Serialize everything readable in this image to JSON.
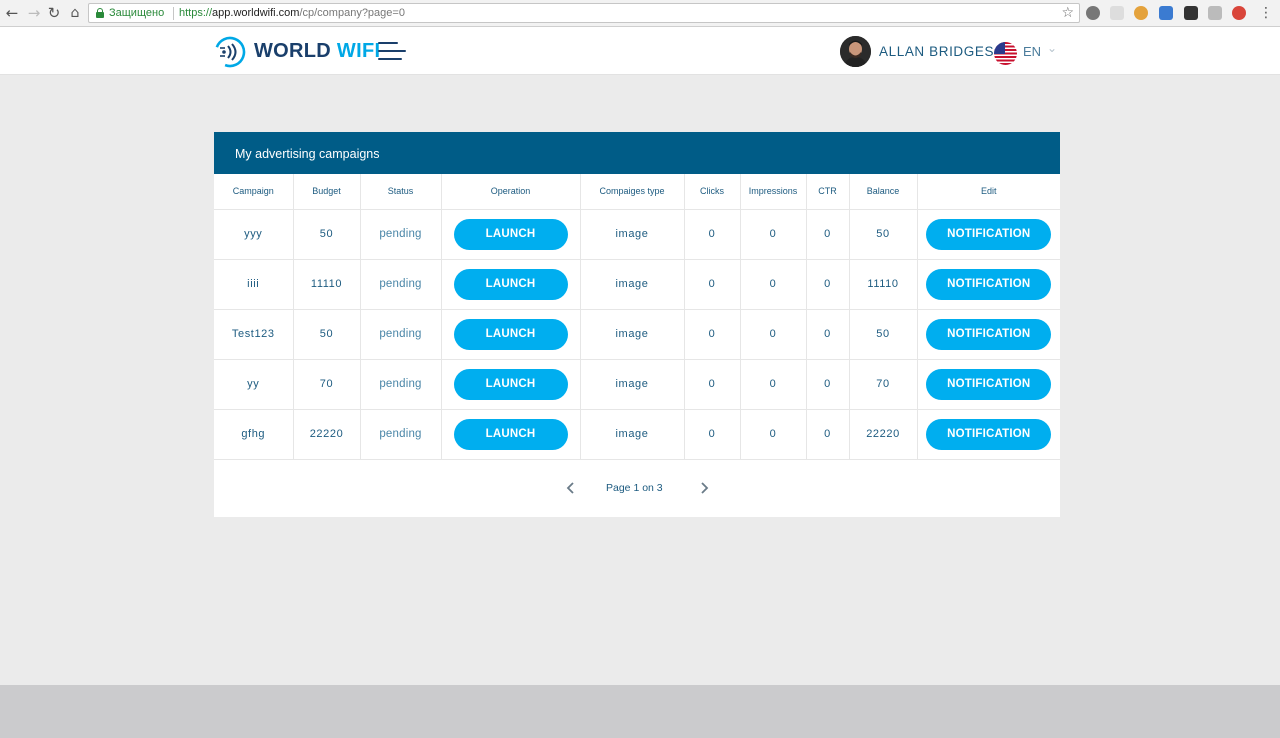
{
  "browser": {
    "secure_label": "Защищено",
    "url_scheme": "https://",
    "url_host": "app.worldwifi.com",
    "url_path": "/cp/company?page=0"
  },
  "header": {
    "logo_word1": "WORLD",
    "logo_word2": "WIFI",
    "user_name": "ALLAN BRIDGES",
    "language": "EN",
    "brand_color": "#00a8e6",
    "navy_color": "#1a3f6b"
  },
  "panel": {
    "title": "My advertising campaigns",
    "header_color": "#005c87",
    "columns": [
      "Campaign",
      "Budget",
      "Status",
      "Operation",
      "Compaiges type",
      "Clicks",
      "Impressions",
      "CTR",
      "Balance",
      "Edit"
    ],
    "rows": [
      {
        "campaign": "yyy",
        "budget": "50",
        "status": "pending",
        "operation": "LAUNCH",
        "type": "image",
        "clicks": "0",
        "impressions": "0",
        "ctr": "0",
        "balance": "50",
        "edit": "NOTIFICATION"
      },
      {
        "campaign": "iiii",
        "budget": "11110",
        "status": "pending",
        "operation": "LAUNCH",
        "type": "image",
        "clicks": "0",
        "impressions": "0",
        "ctr": "0",
        "balance": "11110",
        "edit": "NOTIFICATION"
      },
      {
        "campaign": "Test123",
        "budget": "50",
        "status": "pending",
        "operation": "LAUNCH",
        "type": "image",
        "clicks": "0",
        "impressions": "0",
        "ctr": "0",
        "balance": "50",
        "edit": "NOTIFICATION"
      },
      {
        "campaign": "yy",
        "budget": "70",
        "status": "pending",
        "operation": "LAUNCH",
        "type": "image",
        "clicks": "0",
        "impressions": "0",
        "ctr": "0",
        "balance": "70",
        "edit": "NOTIFICATION"
      },
      {
        "campaign": "gfhg",
        "budget": "22220",
        "status": "pending",
        "operation": "LAUNCH",
        "type": "image",
        "clicks": "0",
        "impressions": "0",
        "ctr": "0",
        "balance": "22220",
        "edit": "NOTIFICATION"
      }
    ],
    "pager": {
      "text": "Page 1 on 3"
    },
    "button_color": "#00aeef"
  }
}
